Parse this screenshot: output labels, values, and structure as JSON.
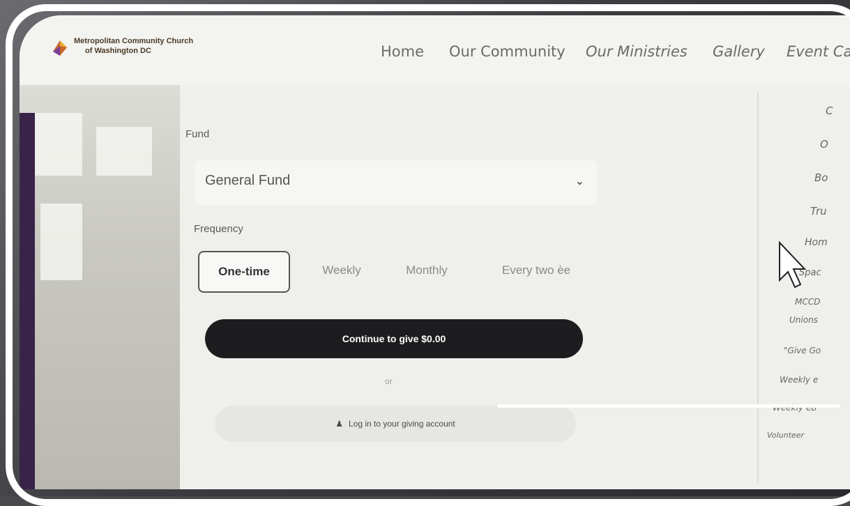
{
  "brand": {
    "line1": "Metropolitan Community Church",
    "line2": "of Washington DC"
  },
  "nav": {
    "items": [
      {
        "label": "Home",
        "italic": false
      },
      {
        "label": "Our Community",
        "italic": false
      },
      {
        "label": "Our Ministries",
        "italic": true
      },
      {
        "label": "Gallery",
        "italic": true
      },
      {
        "label": "Event Ca",
        "italic": true
      }
    ]
  },
  "form": {
    "fund_label": "Fund",
    "fund_value": "General Fund",
    "frequency_label": "Frequency",
    "frequency_options": [
      "One-time",
      "Weekly",
      "Monthly",
      "Every two ѐe"
    ],
    "selected_frequency": "One-time",
    "continue_label": "Continue to give $0.00",
    "or_label": "or",
    "login_label": "Log in to your giving account"
  },
  "sidebar": {
    "items": [
      "C",
      "O",
      "Bo",
      "Tru",
      "Hom",
      "Spac",
      "MCCD",
      "Unions",
      "\"Give Go",
      "Weekly e",
      "Weekly eB",
      "Volunteer"
    ]
  },
  "colors": {
    "accent_dark": "#1d1c1e",
    "background": "#efefec",
    "bezel": "#4a4a4e"
  }
}
